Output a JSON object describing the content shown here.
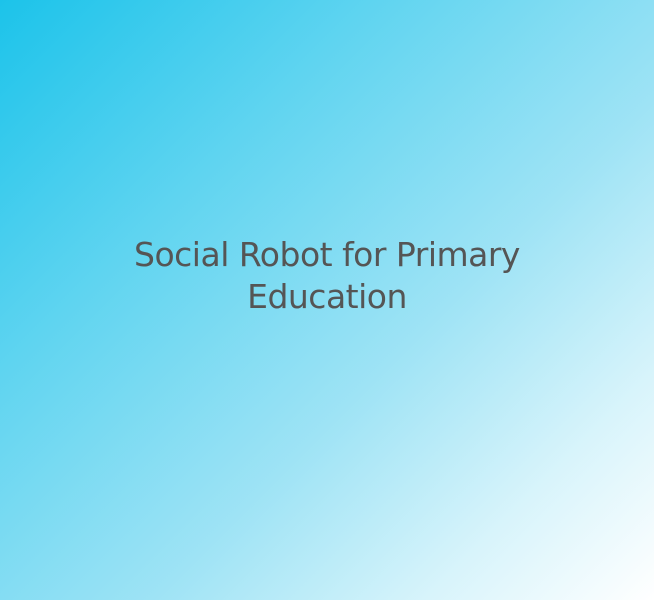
{
  "slide": {
    "title_lines": [
      "Social Robot for Primary",
      "Education"
    ]
  },
  "colors": {
    "text": "#555555",
    "gradient_start": "#1cc3ea",
    "gradient_end": "#ffffff"
  }
}
